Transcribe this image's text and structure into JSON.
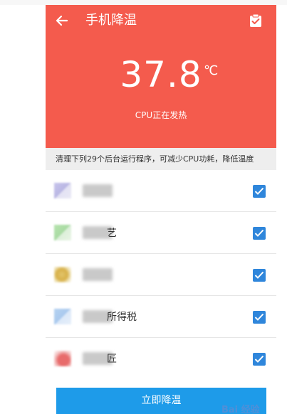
{
  "header": {
    "title": "手机降温",
    "temperature": "37.8",
    "unit": "℃",
    "status": "CPU正在发热",
    "back_icon": "back-arrow-icon",
    "clipboard_icon": "clipboard-check-icon"
  },
  "hint": "清理下列29个后台运行程序，可减少CPU功耗，降低温度",
  "apps": [
    {
      "name": "",
      "icon_color": "#b9b6e3",
      "checked": true
    },
    {
      "name": "艺",
      "icon_color": "#a9dba3",
      "checked": true
    },
    {
      "name": "",
      "icon_color": "#e2c46a",
      "checked": true
    },
    {
      "name": "所得税",
      "icon_color": "#a9c9ee",
      "checked": true
    },
    {
      "name": "匠",
      "icon_color": "#e86b6b",
      "checked": true
    }
  ],
  "button": {
    "label": "立即降温"
  },
  "watermark": "Bai 经验",
  "colors": {
    "header": "#f45b4d",
    "button": "#1e9be9",
    "checkbox": "#2f86db"
  }
}
